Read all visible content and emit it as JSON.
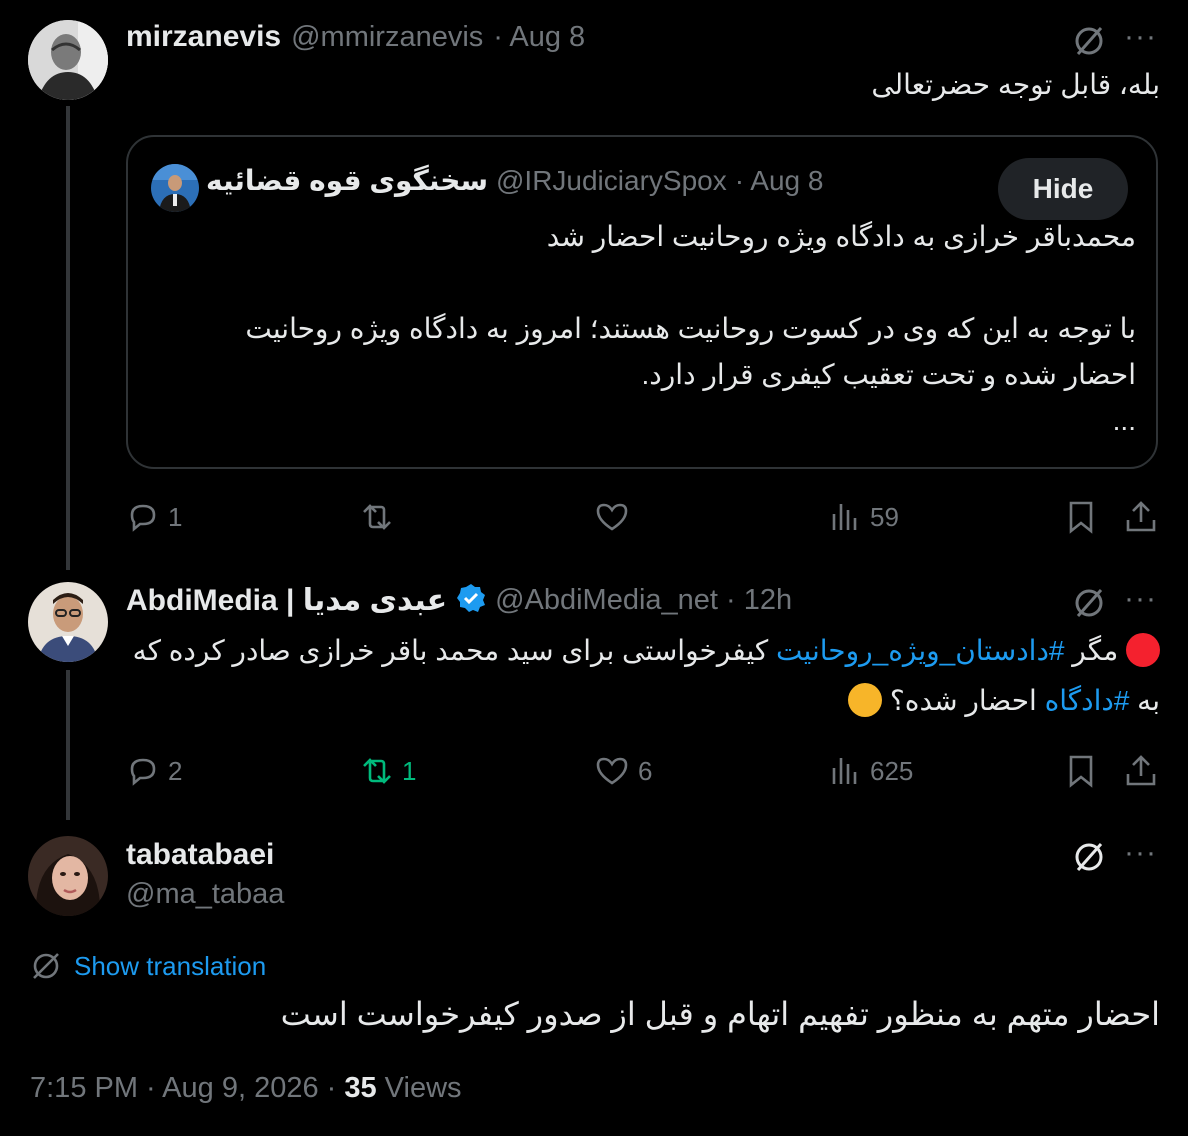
{
  "posts": [
    {
      "display_name": "mirzanevis",
      "handle": "@mmirzanevis",
      "time": "· Aug 8",
      "text": "بله، قابل توجه حضرتعالی",
      "quote": {
        "display_name": "سخنگوی قوه قضائیه",
        "handle": "@IRJudiciarySpox",
        "time": "· Aug 8",
        "hide_label": "Hide",
        "line1": "محمدباقر خرازی به دادگاه ویژه روحانیت احضار شد",
        "line2": "با توجه به این که وی در کسوت روحانیت هستند؛ امروز به دادگاه ویژه روحانیت",
        "line3": "احضار شده و تحت تعقیب کیفری قرار دارد.",
        "line4": "..."
      },
      "actions": {
        "replies": "1",
        "reposts": "",
        "likes": "",
        "views": "59"
      }
    },
    {
      "display_name": "AbdiMedia | عبدی مدیا",
      "handle": "@AbdiMedia_net",
      "time": "· 12h",
      "text_l1_a": "مگر ",
      "hashtag1": "#دادستان_ویژه_روحانیت",
      "text_l1_b": " کیفرخواستی برای سید محمد باقر خرازی صادر کرده که",
      "text_l2_a": "به ",
      "hashtag2": "#دادگاه",
      "text_l2_b": " احضار شده؟",
      "actions": {
        "replies": "2",
        "reposts": "1",
        "likes": "6",
        "views": "625"
      }
    },
    {
      "display_name": "tabatabaei",
      "handle": "@ma_tabaa",
      "show_translation": "Show translation",
      "text": "احضار متهم به منظور تفهیم اتهام و قبل از صدور کیفرخواست است",
      "timestamp": "7:15 PM · Aug 9, 2026 · ",
      "views_count": "35",
      "views_label": " Views"
    }
  ],
  "icons": {
    "more": "more-dots-icon",
    "grok": "grok-slash-icon",
    "reply": "reply-icon",
    "repost": "repost-icon",
    "like": "like-icon",
    "views": "views-icon",
    "bookmark": "bookmark-icon",
    "share": "share-icon",
    "verified": "verified-badge-icon"
  },
  "colors": {
    "accent": "#1d9bf0",
    "muted": "#71767b",
    "repost_active": "#00ba7c",
    "background": "#000000"
  }
}
